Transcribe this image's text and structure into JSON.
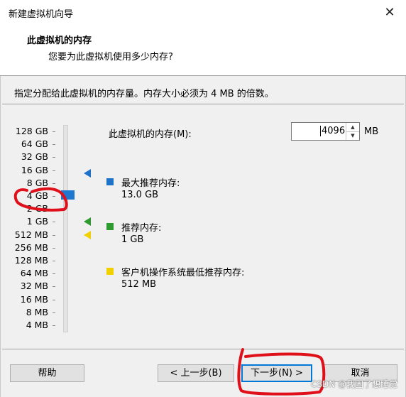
{
  "window": {
    "title": "新建虚拟机向导",
    "close_icon": "close-icon"
  },
  "header": {
    "heading": "此虚拟机的内存",
    "subheading": "您要为此虚拟机使用多少内存?"
  },
  "instruction": "指定分配给此虚拟机的内存量。内存大小必须为 4 MB 的倍数。",
  "scale_ticks": [
    "128 GB",
    "64 GB",
    "32 GB",
    "16 GB",
    "8 GB",
    "4 GB",
    "2 GB",
    "1 GB",
    "512 MB",
    "256 MB",
    "128 MB",
    "64 MB",
    "32 MB",
    "16 MB",
    "8 MB",
    "4 MB"
  ],
  "memory": {
    "label": "此虚拟机的内存(M):",
    "value": "4096",
    "unit": "MB"
  },
  "legend": {
    "max": {
      "label": "最大推荐内存:",
      "value": "13.0 GB",
      "color": "#1e72c8"
    },
    "recommended": {
      "label": "推荐内存:",
      "value": "1 GB",
      "color": "#2f9a2f"
    },
    "guest_min": {
      "label": "客户机操作系统最低推荐内存:",
      "value": "512 MB",
      "color": "#f0d000"
    }
  },
  "buttons": {
    "help": "帮助",
    "back": "< 上一步(B)",
    "next": "下一步(N) >",
    "cancel": "取消"
  },
  "watermark": "CSDN @我困了想睡觉"
}
